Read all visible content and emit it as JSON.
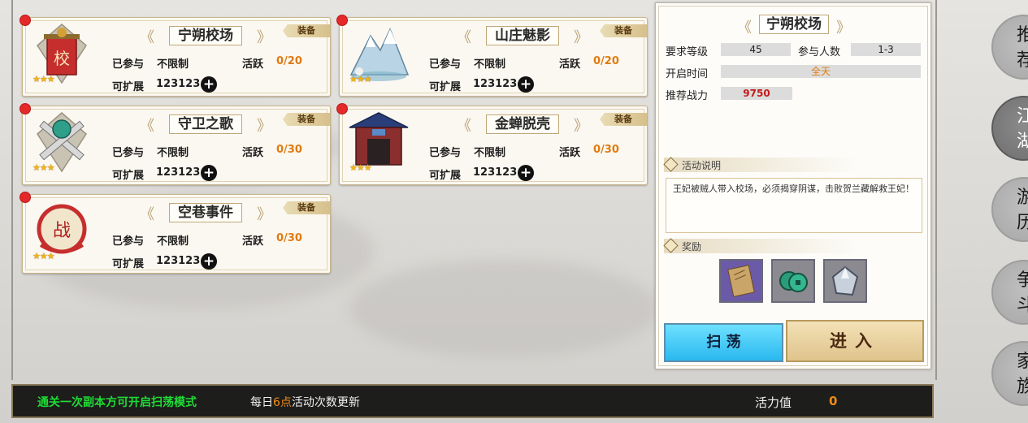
{
  "colors": {
    "accent_orange": "#e07a10",
    "green_hint": "#1fdc36",
    "red_dot": "#e5282a",
    "sweep_blue": "#2ab8ee"
  },
  "cards": [
    {
      "title": "宁朔校场",
      "tag": "装备",
      "joined_label": "已参与",
      "joined_value": "不限制",
      "active_label": "活跃",
      "active_value": "0/20",
      "expand_label": "可扩展",
      "expand_value": "123123",
      "stars": "★★★",
      "icon": "flag-banner-icon"
    },
    {
      "title": "山庄魅影",
      "tag": "装备",
      "joined_label": "已参与",
      "joined_value": "不限制",
      "active_label": "活跃",
      "active_value": "0/20",
      "expand_label": "可扩展",
      "expand_value": "123123",
      "stars": "★★★",
      "icon": "mountain-icon"
    },
    {
      "title": "守卫之歌",
      "tag": "装备",
      "joined_label": "已参与",
      "joined_value": "不限制",
      "active_label": "活跃",
      "active_value": "0/30",
      "expand_label": "可扩展",
      "expand_value": "123123",
      "stars": "★★★",
      "icon": "crossed-swords-icon"
    },
    {
      "title": "金蝉脱壳",
      "tag": "装备",
      "joined_label": "已参与",
      "joined_value": "不限制",
      "active_label": "活跃",
      "active_value": "0/30",
      "expand_label": "可扩展",
      "expand_value": "123123",
      "stars": "★★★",
      "icon": "gate-icon"
    },
    {
      "title": "空巷事件",
      "tag": "装备",
      "joined_label": "已参与",
      "joined_value": "不限制",
      "active_label": "活跃",
      "active_value": "0/30",
      "expand_label": "可扩展",
      "expand_value": "123123",
      "stars": "★★★",
      "icon": "battle-seal-icon"
    }
  ],
  "detail": {
    "title": "宁朔校场",
    "req_level_label": "要求等级",
    "req_level": "45",
    "players_label": "参与人数",
    "players": "1-3",
    "open_time_label": "开启时间",
    "open_time": "全天",
    "power_label": "推荐战力",
    "power": "9750",
    "desc_header": "活动说明",
    "desc": "王妃被贼人带入校场，必须揭穿阴谋，击败贺兰藏解救王妃！",
    "reward_header": "奖励",
    "rewards": [
      "book-icon",
      "coins-icon",
      "crystal-icon"
    ],
    "sweep_label": "扫 荡",
    "enter_label": "进入"
  },
  "tabs": [
    {
      "label": "推荐",
      "active": false
    },
    {
      "label": "江湖",
      "active": true
    },
    {
      "label": "游历",
      "active": false
    },
    {
      "label": "争斗",
      "active": false
    },
    {
      "label": "家族",
      "active": false
    }
  ],
  "bottom": {
    "hint": "通关一次副本方可开启扫荡模式",
    "daily_prefix": "每日",
    "daily_hour": "6点",
    "daily_suffix": "活动次数更新",
    "vitality_label": "活力值",
    "vitality_value": "0"
  }
}
